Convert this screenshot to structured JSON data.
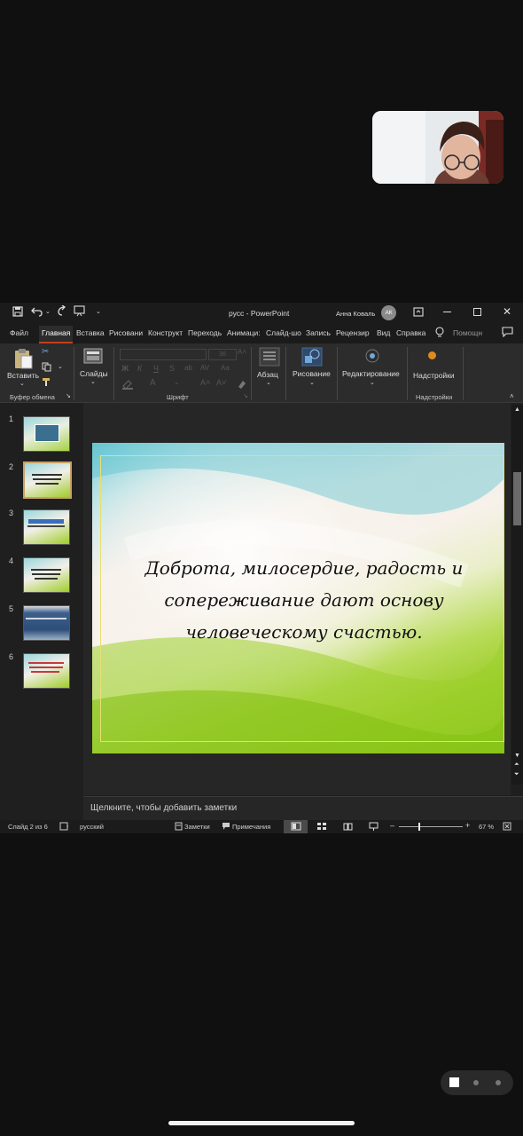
{
  "window": {
    "title": "русс  -  PowerPoint",
    "user_name": "Анна Коваль",
    "user_initials": "АК"
  },
  "tabs": [
    "Файл",
    "Главная",
    "Вставка",
    "Рисовани",
    "Конструкт",
    "Переходь",
    "Анимаци:",
    "Слайд-шо",
    "Запись",
    "Рецензир",
    "Вид",
    "Справка"
  ],
  "search_placeholder": "Помощн",
  "ribbon": {
    "paste_label": "Вставить",
    "clipboard_group": "Буфер обмена",
    "slides_label": "Слайды",
    "font_group": "Шрифт",
    "font_size": "36",
    "paragraph_label": "Абзац",
    "drawing_label": "Рисование",
    "editing_label": "Редактирование",
    "addins_label": "Надстройки",
    "addins_group": "Надстройки"
  },
  "slides": [
    {
      "num": "1"
    },
    {
      "num": "2"
    },
    {
      "num": "3"
    },
    {
      "num": "4"
    },
    {
      "num": "5"
    },
    {
      "num": "6"
    }
  ],
  "current_slide": {
    "line1": "Доброта, милосердие, радость и",
    "line2": "сопереживание дают основу",
    "line3": "человеческому счастью."
  },
  "notes_placeholder": "Щелкните, чтобы добавить заметки",
  "status": {
    "slide_counter": "Слайд 2 из 6",
    "language": "русский",
    "notes_btn": "Заметки",
    "comments_btn": "Примечания",
    "zoom_percent": "67 %"
  },
  "colors": {
    "accent": "#c43e1c",
    "selected_thumb_border": "#c9a064"
  }
}
